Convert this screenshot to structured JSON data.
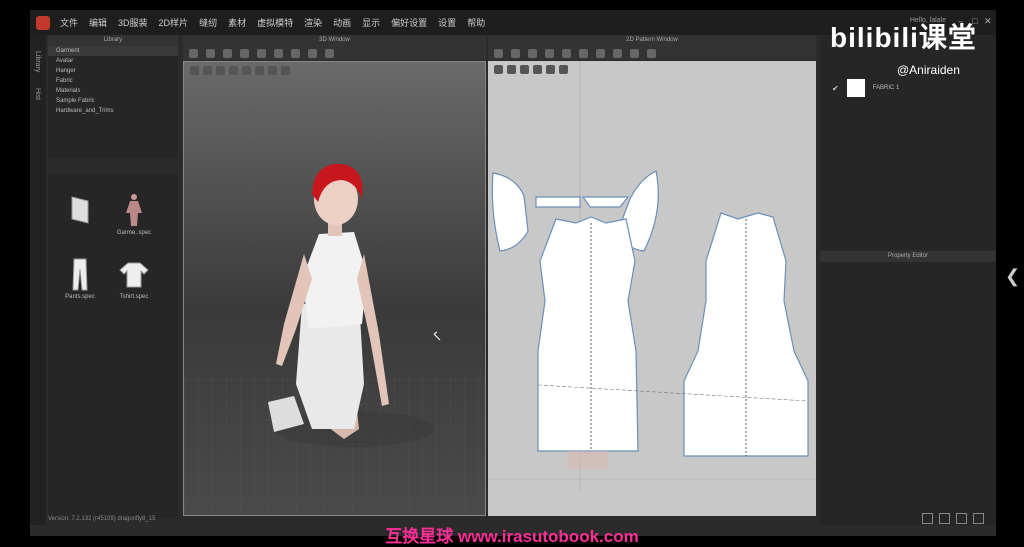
{
  "menu": [
    "文件",
    "编辑",
    "3D服装",
    "2D样片",
    "缝纫",
    "素材",
    "虚拟模特",
    "渲染",
    "动画",
    "显示",
    "偏好设置",
    "设置",
    "帮助"
  ],
  "window_title": "Hello, lalale",
  "left_tabs": [
    "Library",
    "Hist"
  ],
  "library": {
    "header": "Library",
    "tree": [
      "Garment",
      "Avatar",
      "Hanger",
      "Fabric",
      "Materials",
      "Sample Fabric",
      "Hardware_and_Trims"
    ],
    "items": [
      {
        "label": ""
      },
      {
        "label": "Garme..spec"
      },
      {
        "label": "Pants.spec"
      },
      {
        "label": "Tshirt.spec"
      }
    ]
  },
  "status_bar": "Version: 7.2.132 (r45109)  dragonfly8_15",
  "window_3d": {
    "title": "3D Window"
  },
  "window_2d": {
    "title": "2D Pattern Window"
  },
  "object_browser": {
    "item": "FABRIC 1"
  },
  "property_editor": {
    "title": "Property Editor"
  },
  "watermarks": {
    "bili": "bilibili课堂",
    "handle": "@Aniraiden",
    "banner": "互换星球 www.irasutobook.com"
  },
  "colors": {
    "hair": "#c8161d",
    "fabric_outline": "#6b8fb8"
  }
}
